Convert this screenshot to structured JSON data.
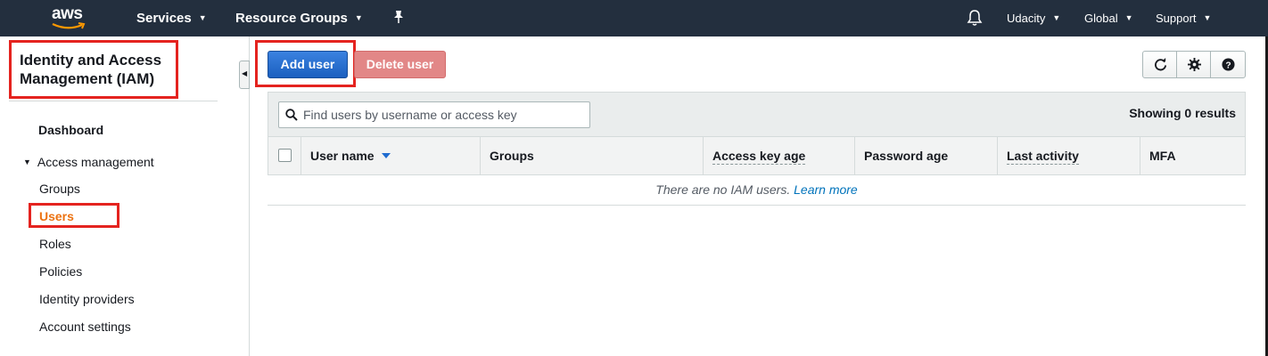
{
  "topnav": {
    "logo": "aws",
    "services": "Services",
    "resource_groups": "Resource Groups",
    "account": "Udacity",
    "region": "Global",
    "support": "Support",
    "icons": [
      "pin-icon",
      "bell-icon"
    ]
  },
  "sidebar": {
    "title": "Identity and Access Management (IAM)",
    "dashboard": "Dashboard",
    "section": "Access management",
    "items": [
      {
        "label": "Groups",
        "active": false
      },
      {
        "label": "Users",
        "active": true
      },
      {
        "label": "Roles",
        "active": false
      },
      {
        "label": "Policies",
        "active": false
      },
      {
        "label": "Identity providers",
        "active": false
      },
      {
        "label": "Account settings",
        "active": false
      }
    ]
  },
  "toolbar": {
    "add_user": "Add user",
    "delete_user": "Delete user",
    "icons": [
      "refresh-icon",
      "gear-icon",
      "help-icon"
    ]
  },
  "table": {
    "search_placeholder": "Find users by username or access key",
    "search_value": "",
    "showing": "Showing 0 results",
    "columns": [
      "User name",
      "Groups",
      "Access key age",
      "Password age",
      "Last activity",
      "MFA"
    ],
    "empty_message": "There are no IAM users.",
    "learn_more": "Learn more"
  },
  "colors": {
    "nav_bg": "#232f3e",
    "primary": "#1f6bd0",
    "active_nav": "#ec7211",
    "annotation": "#e4231f",
    "delete_disabled": "#e28787"
  }
}
